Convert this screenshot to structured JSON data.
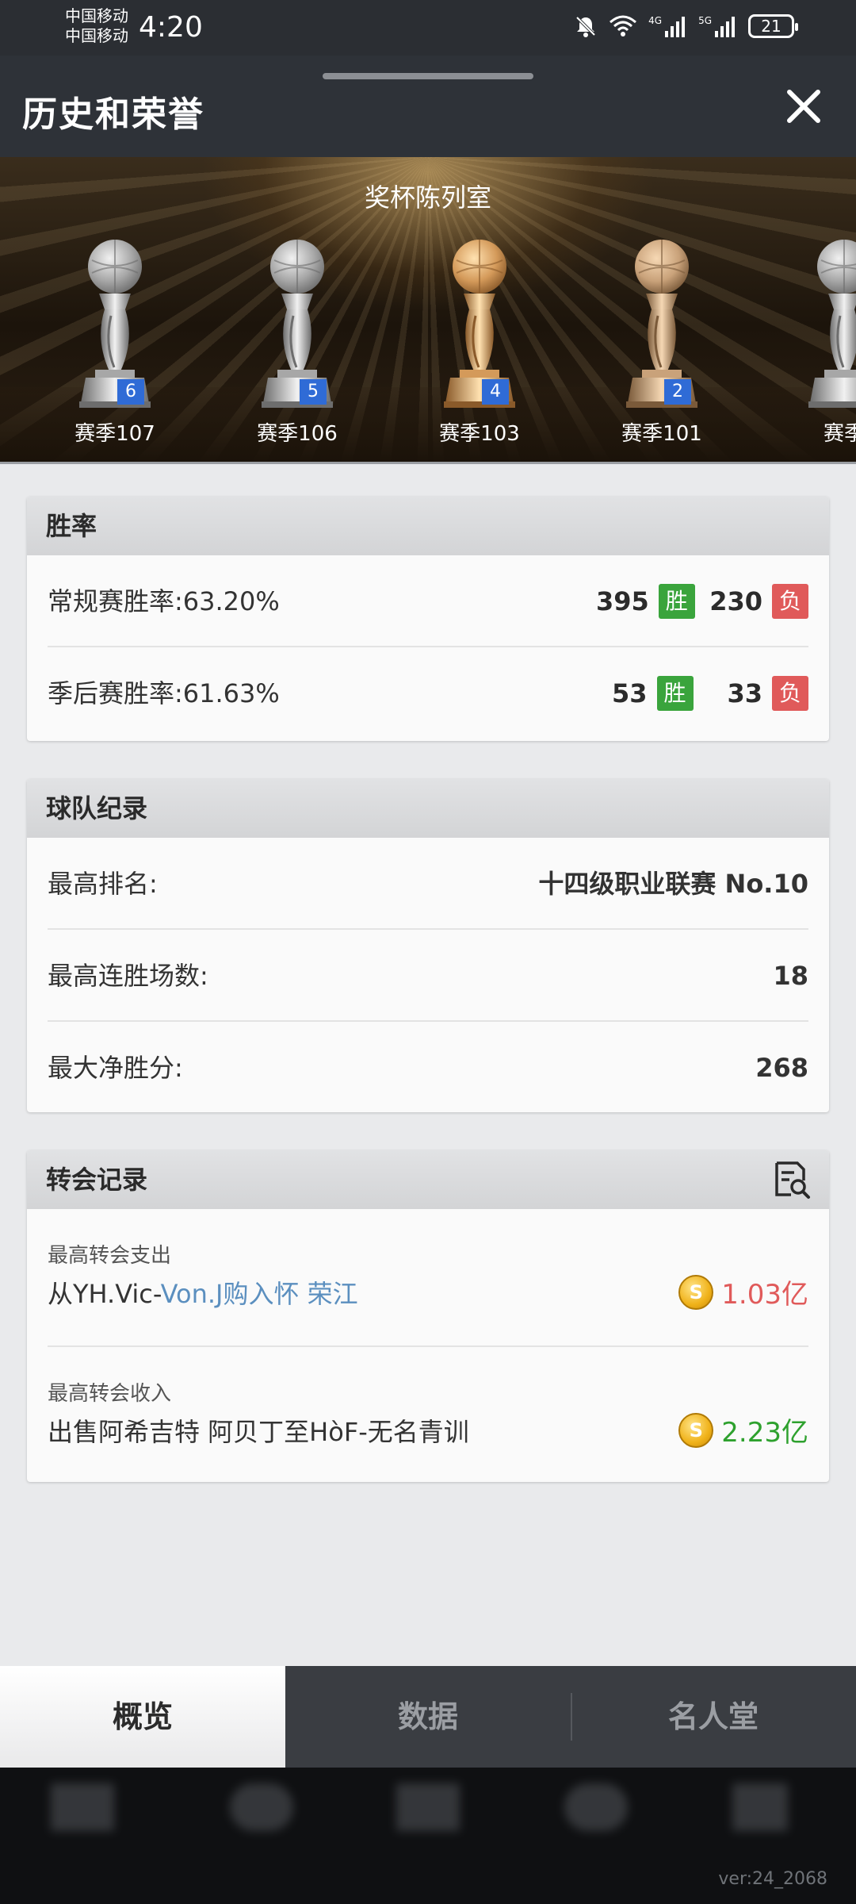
{
  "status_bar": {
    "carrier_1": "中国移动",
    "carrier_2": "中国移动",
    "time": "4:20",
    "battery": "21",
    "net_1": "4G",
    "net_2": "5G"
  },
  "header": {
    "title": "历史和荣誉",
    "close_icon": "close-icon"
  },
  "trophy_room": {
    "title": "奖杯陈列室",
    "trophies": [
      {
        "label": "赛季107",
        "count": "6"
      },
      {
        "label": "赛季106",
        "count": "5"
      },
      {
        "label": "赛季103",
        "count": "4"
      },
      {
        "label": "赛季101",
        "count": "2"
      },
      {
        "label": "赛季",
        "count": ""
      }
    ]
  },
  "win_rate": {
    "title": "胜率",
    "regular": {
      "label": "常规赛胜率:63.20%",
      "wins": "395",
      "win_tag": "胜",
      "losses": "230",
      "loss_tag": "负"
    },
    "playoff": {
      "label": "季后赛胜率:61.63%",
      "wins": "53",
      "win_tag": "胜",
      "losses": "33",
      "loss_tag": "负"
    }
  },
  "team_records": {
    "title": "球队纪录",
    "rows": [
      {
        "label": "最高排名:",
        "value": "十四级职业联赛 No.10"
      },
      {
        "label": "最高连胜场数:",
        "value": "18"
      },
      {
        "label": "最大净胜分:",
        "value": "268"
      }
    ]
  },
  "transfer_records": {
    "title": "转会记录",
    "icon": "search-document-icon",
    "spend": {
      "sub": "最高转会支出",
      "prefix": "从YH.Vic-",
      "highlight": "Von.J",
      "suffix": "购入怀 荣江",
      "amount": "1.03亿",
      "color": "#e05a5a"
    },
    "income": {
      "sub": "最高转会收入",
      "desc": "出售阿希吉特 阿贝丁至HòF-无名青训",
      "amount": "2.23亿",
      "color": "#2ea12e"
    },
    "coin_symbol": "S"
  },
  "tabs": [
    {
      "label": "概览",
      "active": true
    },
    {
      "label": "数据",
      "active": false
    },
    {
      "label": "名人堂",
      "active": false
    }
  ],
  "version": "ver:24_2068"
}
